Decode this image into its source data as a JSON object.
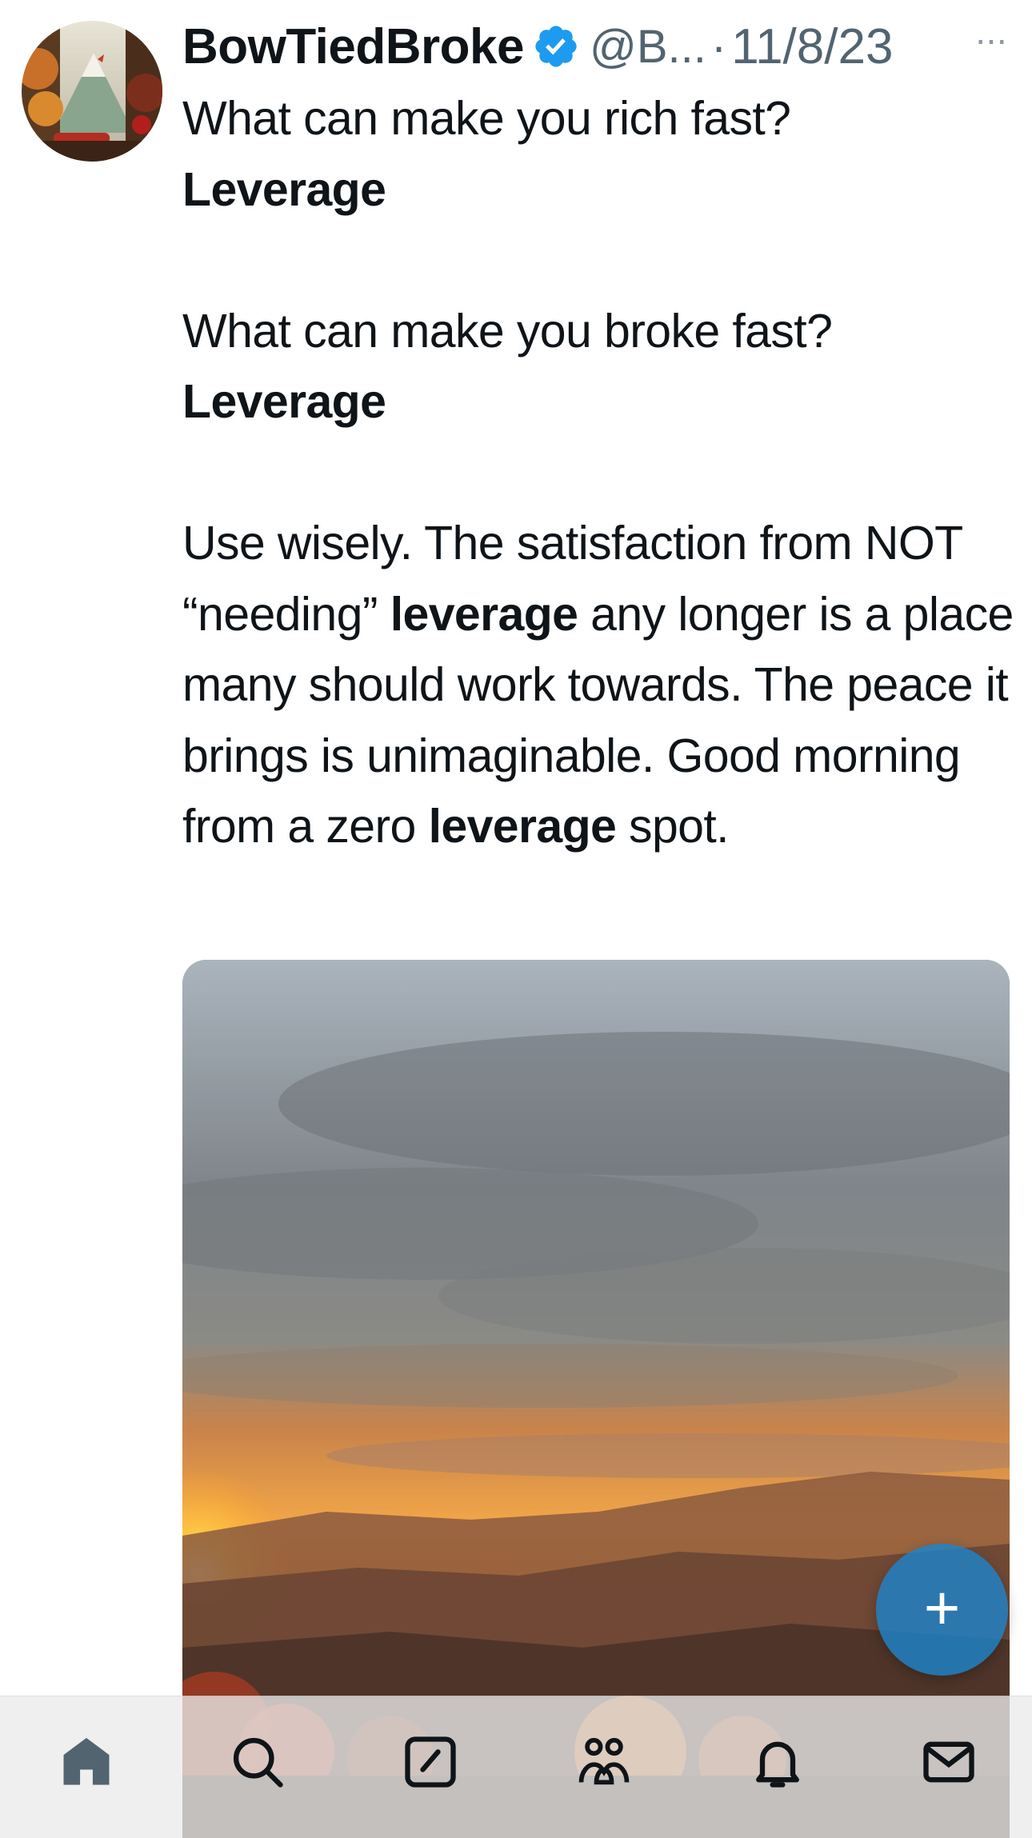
{
  "tweet": {
    "display_name": "BowTiedBroke",
    "handle": "@B...",
    "separator": "·",
    "date": "11/8/23",
    "more_label": "···",
    "text": {
      "line1": "What can make you rich fast?",
      "line2": "Leverage",
      "line3": "What can make you broke fast?",
      "line4": "Leverage",
      "p3_a": "Use wisely. The satisfaction from NOT “needing” ",
      "p3_b": "leverage",
      "p3_c": " any longer is a place many should work towards. The peace it brings is unimaginable. Good morning from a zero ",
      "p3_d": "leverage",
      "p3_e": " spot."
    },
    "media": {
      "type": "photo",
      "subject": "sunset-over-mountains"
    }
  },
  "fab": {
    "label": "+"
  },
  "tabbar": {
    "items": [
      {
        "icon": "home-icon",
        "active": true
      },
      {
        "icon": "search-icon"
      },
      {
        "icon": "compose-icon"
      },
      {
        "icon": "communities-icon"
      },
      {
        "icon": "bell-icon"
      },
      {
        "icon": "mail-icon"
      }
    ]
  },
  "colors": {
    "text": "#0f1419",
    "secondary": "#536471",
    "verified": "#1d9bf0",
    "fab": "#1d83c9"
  }
}
